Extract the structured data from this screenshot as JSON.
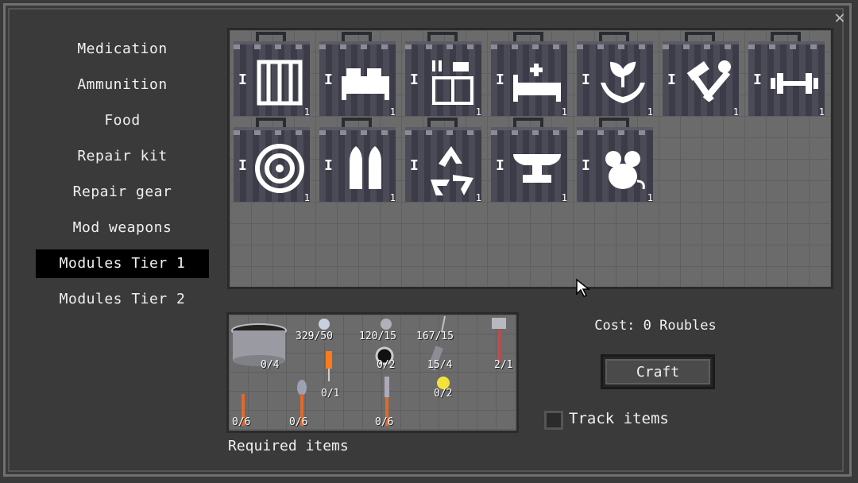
{
  "categories": [
    {
      "label": "Medication",
      "active": false
    },
    {
      "label": "Ammunition",
      "active": false
    },
    {
      "label": "Food",
      "active": false
    },
    {
      "label": "Repair kit",
      "active": false
    },
    {
      "label": "Repair gear",
      "active": false
    },
    {
      "label": "Mod weapons",
      "active": false
    },
    {
      "label": "Modules Tier 1",
      "active": true
    },
    {
      "label": "Modules Tier 2",
      "active": false
    }
  ],
  "modules": [
    {
      "tier": "I",
      "qty": "1",
      "icon": "crate-icon"
    },
    {
      "tier": "I",
      "qty": "1",
      "icon": "bed-icon"
    },
    {
      "tier": "I",
      "qty": "1",
      "icon": "kitchen-icon"
    },
    {
      "tier": "I",
      "qty": "1",
      "icon": "medical-bed-icon"
    },
    {
      "tier": "I",
      "qty": "1",
      "icon": "plant-hands-icon"
    },
    {
      "tier": "I",
      "qty": "1",
      "icon": "hammer-wrench-icon"
    },
    {
      "tier": "I",
      "qty": "1",
      "icon": "dumbbell-icon"
    },
    {
      "tier": "I",
      "qty": "1",
      "icon": "target-icon"
    },
    {
      "tier": "I",
      "qty": "1",
      "icon": "ammo-icon"
    },
    {
      "tier": "I",
      "qty": "1",
      "icon": "recycle-icon"
    },
    {
      "tier": "I",
      "qty": "1",
      "icon": "anvil-icon"
    },
    {
      "tier": "I",
      "qty": "1",
      "icon": "mouse-icon"
    }
  ],
  "required_items": [
    {
      "count": "0/4",
      "icon": "pot-icon"
    },
    {
      "count": "329/50",
      "icon": "bolts-icon"
    },
    {
      "count": "120/15",
      "icon": "screws-icon"
    },
    {
      "count": "167/15",
      "icon": "nails-icon"
    },
    {
      "count": "2/1",
      "icon": "axe-icon"
    },
    {
      "count": "0/2",
      "icon": "tape-icon"
    },
    {
      "count": "15/4",
      "icon": "pipe-icon"
    },
    {
      "count": "0/1",
      "icon": "screwdriver-icon"
    },
    {
      "count": "0/2",
      "icon": "bulb-icon"
    },
    {
      "count": "0/6",
      "icon": "fork-icon"
    },
    {
      "count": "0/6",
      "icon": "spoon-icon"
    },
    {
      "count": "0/6",
      "icon": "knife-icon"
    }
  ],
  "required_label": "Required items",
  "cost_text": "Cost: 0 Roubles",
  "craft_label": "Craft",
  "track_label": "Track items",
  "track_checked": false,
  "close_icon": "close-icon"
}
